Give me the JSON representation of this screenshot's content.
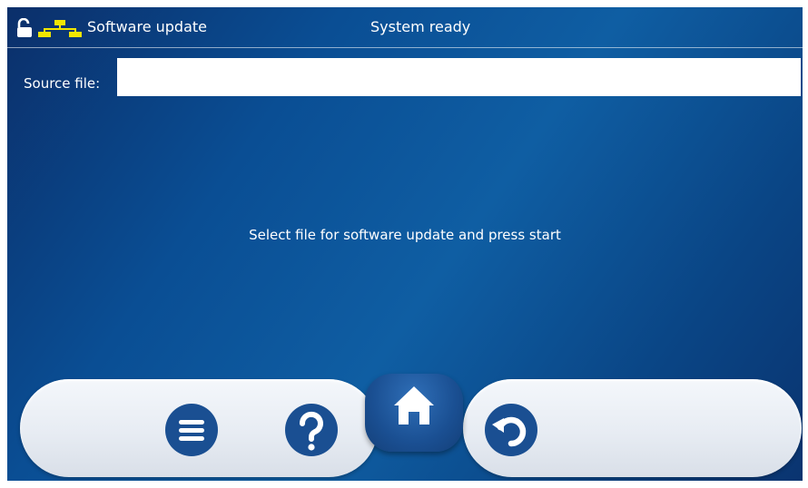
{
  "header": {
    "title": "Software update",
    "status": "System ready",
    "icons": [
      "lock-open-icon",
      "network-icon"
    ],
    "accent_color": "#f2e600"
  },
  "source": {
    "label": "Source file:",
    "value": ""
  },
  "message": "Select file for software update and press start",
  "dock": {
    "buttons": [
      {
        "name": "menu",
        "icon": "menu-icon"
      },
      {
        "name": "help",
        "icon": "help-icon"
      },
      {
        "name": "home",
        "icon": "home-icon"
      },
      {
        "name": "back",
        "icon": "undo-icon"
      }
    ]
  },
  "colors": {
    "background": "#0a4e94",
    "button": "#1a4f92",
    "dock": "#e7ecf3"
  }
}
